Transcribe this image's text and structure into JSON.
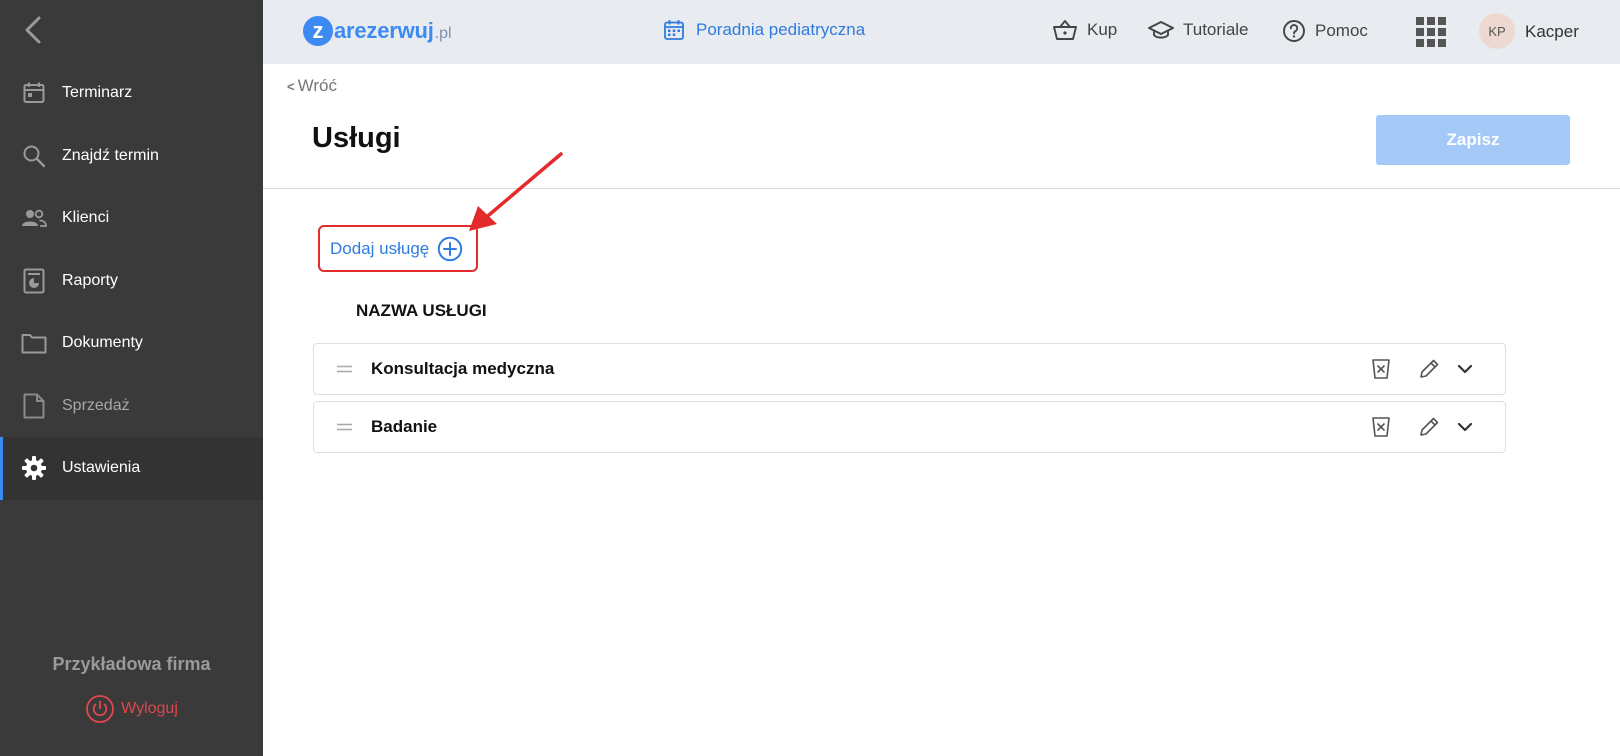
{
  "sidebar": {
    "items": [
      {
        "label": "Terminarz",
        "icon": "calendar-icon"
      },
      {
        "label": "Znajdź termin",
        "icon": "search-icon"
      },
      {
        "label": "Klienci",
        "icon": "people-icon"
      },
      {
        "label": "Raporty",
        "icon": "report-icon"
      },
      {
        "label": "Dokumenty",
        "icon": "folder-icon"
      },
      {
        "label": "Sprzedaż",
        "icon": "document-icon"
      },
      {
        "label": "Ustawienia",
        "icon": "gear-icon"
      }
    ],
    "company": "Przykładowa firma",
    "logout": "Wyloguj"
  },
  "header": {
    "logo_letter": "z",
    "logo_text": "arezerwuj",
    "logo_tld": ".pl",
    "clinic": "Poradnia pediatryczna",
    "buy": "Kup",
    "tutorials": "Tutoriale",
    "help": "Pomoc",
    "avatar_initials": "KP",
    "user": "Kacper"
  },
  "main": {
    "back": "Wróć",
    "title": "Usługi",
    "save": "Zapisz",
    "add_service": "Dodaj usługę",
    "column_header": "NAZWA USŁUGI",
    "services": [
      {
        "name": "Konsultacja medyczna"
      },
      {
        "name": "Badanie"
      }
    ]
  },
  "colors": {
    "accent": "#3d8bf2",
    "sidebar_bg": "#3a3a3a",
    "highlight": "#e32b2b",
    "save_disabled": "#a4c9f7"
  }
}
